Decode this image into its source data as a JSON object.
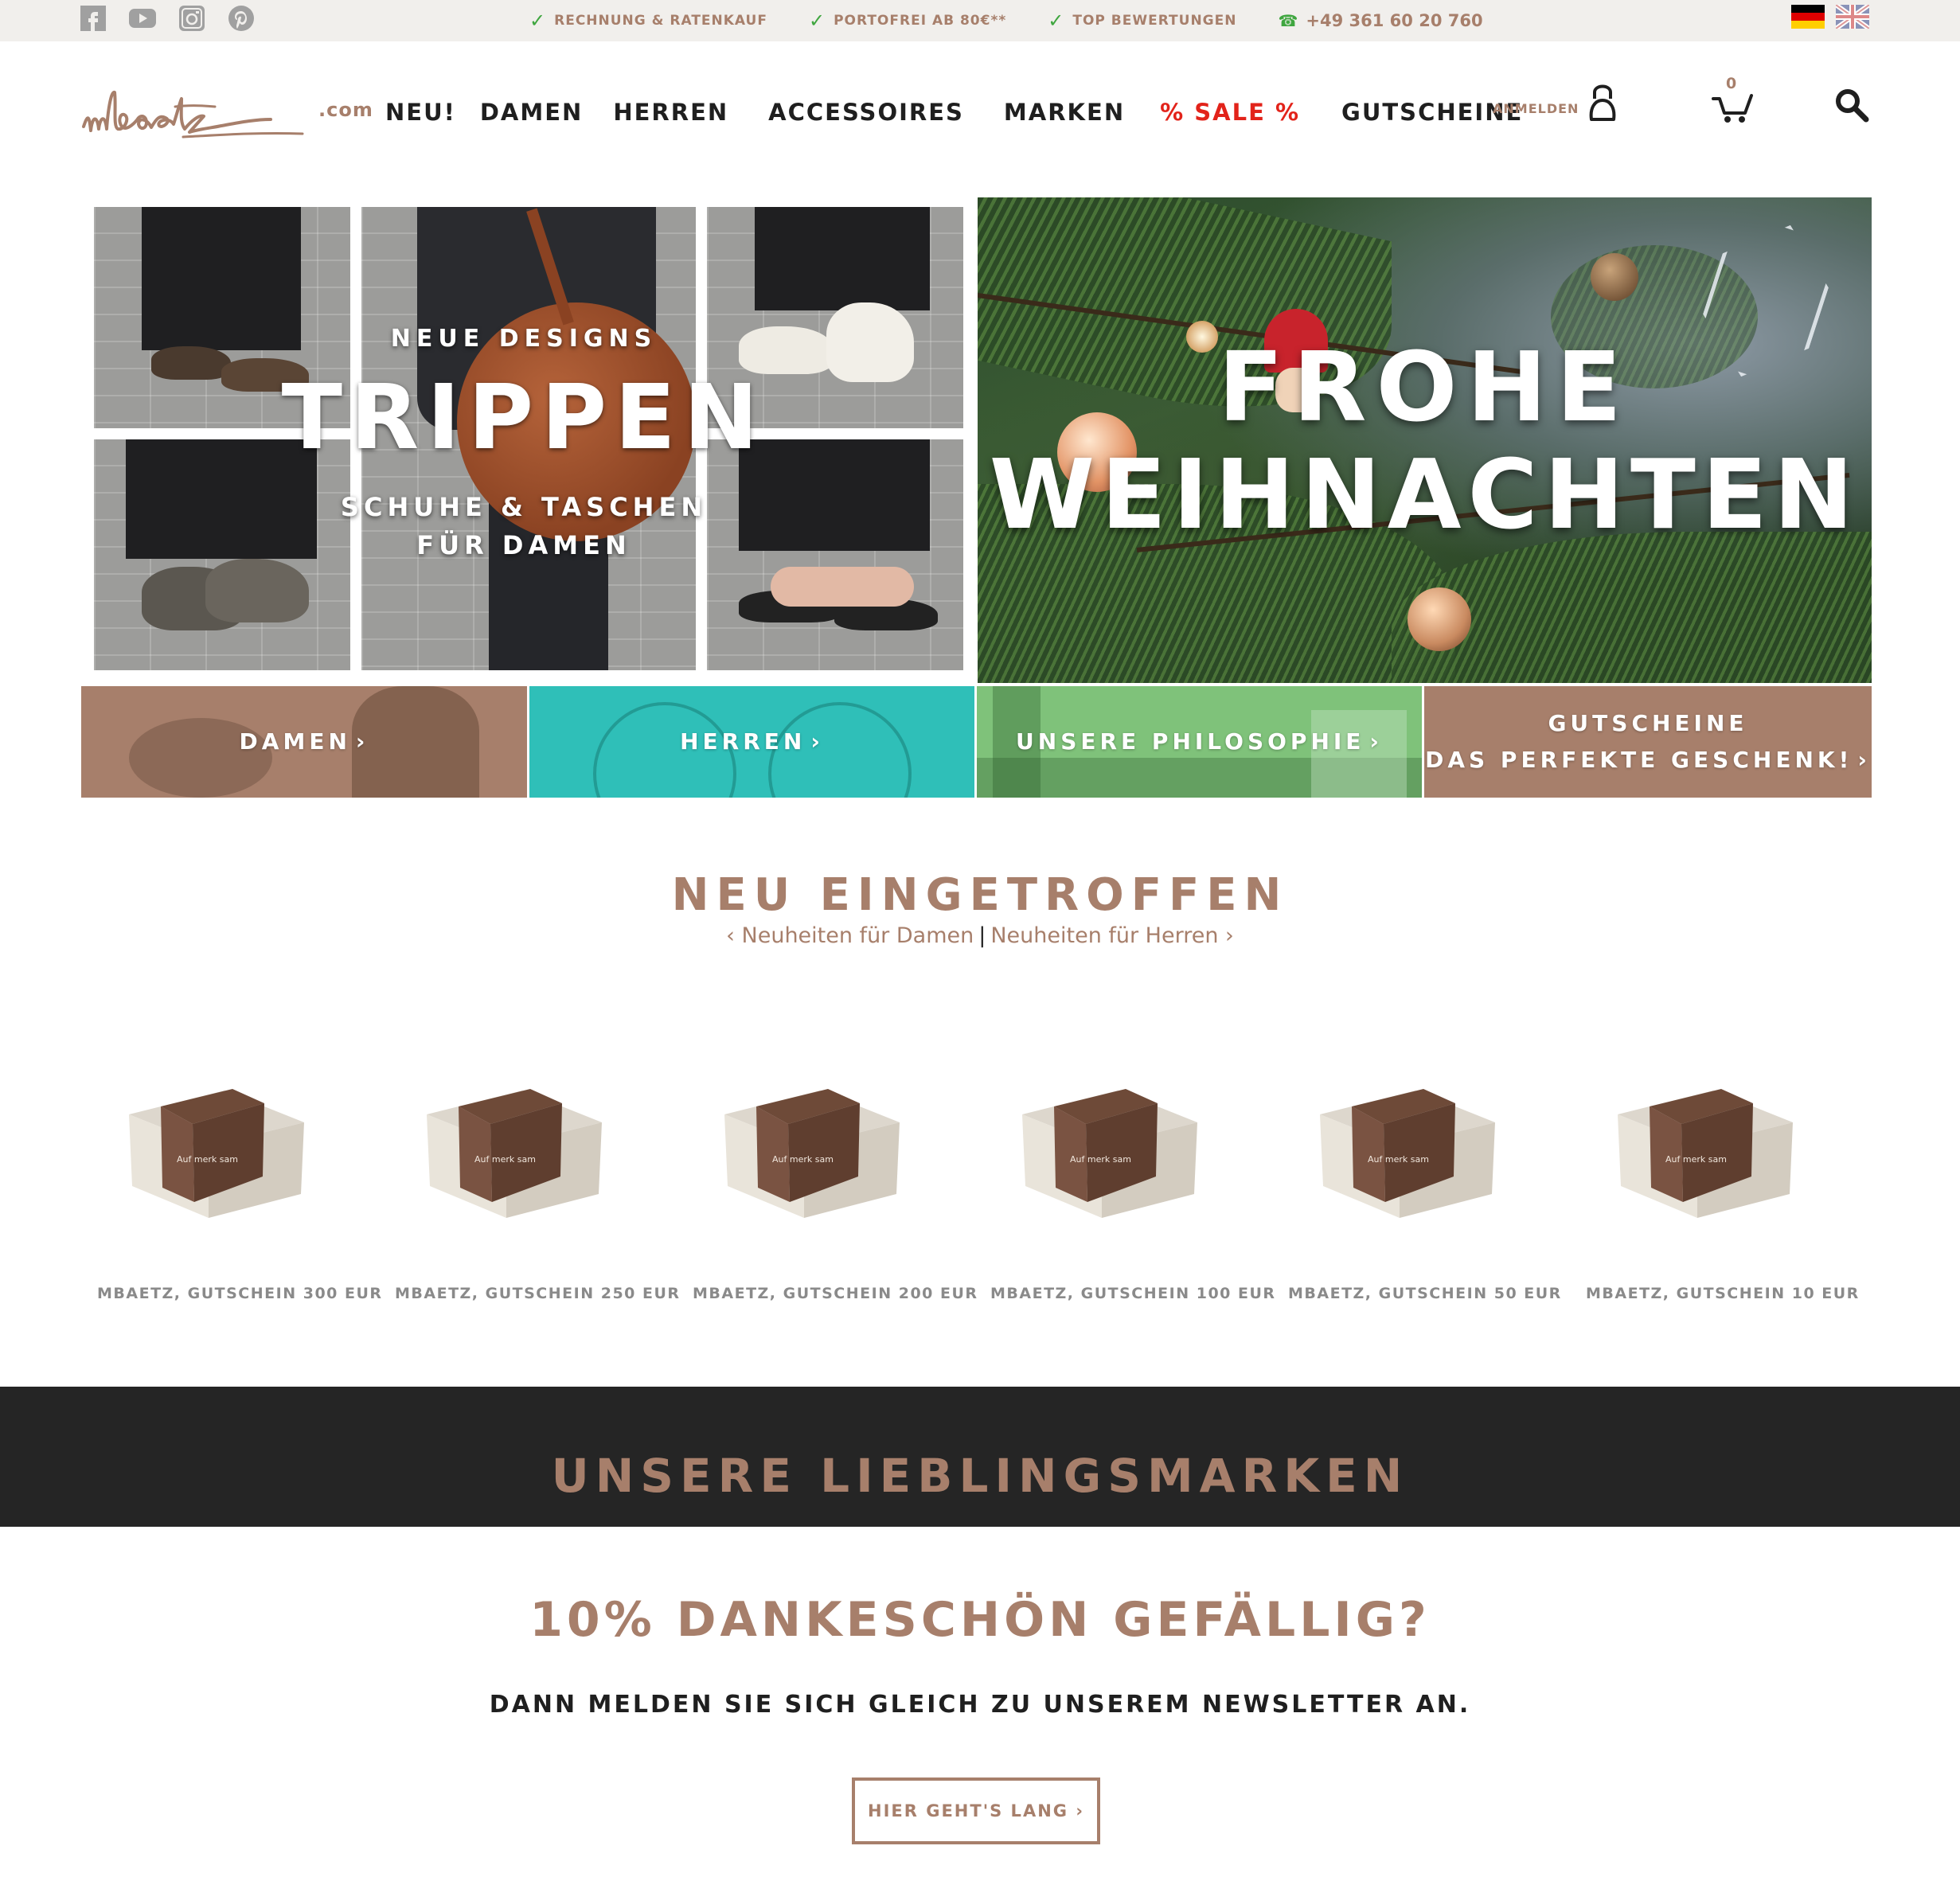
{
  "topbar": {
    "social": [
      {
        "name": "facebook-icon"
      },
      {
        "name": "youtube-icon"
      },
      {
        "name": "instagram-icon"
      },
      {
        "name": "pinterest-icon"
      }
    ],
    "usps": [
      {
        "label": "RECHNUNG & RATENKAUF"
      },
      {
        "label": "PORTOFREI AB 80€**"
      },
      {
        "label": "TOP BEWERTUNGEN"
      }
    ],
    "phone": "+49 361 60 20 760",
    "languages": [
      "de-flag-icon",
      "uk-flag-icon"
    ]
  },
  "header": {
    "logo_text": "mbaetz",
    "logo_suffix": ".com",
    "nav": [
      {
        "label": "NEU!"
      },
      {
        "label": "DAMEN"
      },
      {
        "label": "HERREN"
      },
      {
        "label": "ACCESSOIRES"
      },
      {
        "label": "MARKEN"
      },
      {
        "label": "% SALE %"
      },
      {
        "label": "GUTSCHEINE"
      }
    ],
    "login_label": "ANMELDEN",
    "cart_count": "0"
  },
  "hero": {
    "left": {
      "kicker": "NEUE DESIGNS",
      "title": "TRIPPEN",
      "line1": "SCHUHE & TASCHEN",
      "line2": "FÜR DAMEN"
    },
    "right": {
      "line1": "FROHE",
      "line2": "WEIHNACHTEN"
    }
  },
  "categories": [
    {
      "label": "DAMEN",
      "color": "#a77f6b"
    },
    {
      "label": "HERREN",
      "color": "#2fbfb8"
    },
    {
      "label": "UNSERE PHILOSOPHIE",
      "color": "#7fc27a"
    },
    {
      "label_line1": "GUTSCHEINE",
      "label_line2": "DAS PERFEKTE GESCHENK!",
      "color": "#a77f6b"
    }
  ],
  "new_arrivals": {
    "title": "NEU EINGETROFFEN",
    "link_women": "‹ Neuheiten für Damen",
    "separator": "|",
    "link_men": "Neuheiten für Herren ›",
    "products": [
      {
        "name": "MBAETZ, GUTSCHEIN 300 EUR"
      },
      {
        "name": "MBAETZ, GUTSCHEIN 250 EUR"
      },
      {
        "name": "MBAETZ, GUTSCHEIN 200 EUR"
      },
      {
        "name": "MBAETZ, GUTSCHEIN 100 EUR"
      },
      {
        "name": "MBAETZ, GUTSCHEIN 50 EUR"
      },
      {
        "name": "MBAETZ, GUTSCHEIN 10 EUR"
      }
    ],
    "box_label": "Auf merk sam"
  },
  "brands": {
    "title": "UNSERE LIEBLINGSMARKEN"
  },
  "newsletter": {
    "title": "10% DANKESCHÖN GEFÄLLIG?",
    "subtitle": "DANN MELDEN SIE SICH GLEICH ZU UNSEREM NEWSLETTER AN.",
    "button_label": "HIER GEHT'S LANG ›"
  },
  "colors": {
    "accent": "#a77f6b",
    "sale": "#e2231a",
    "check": "#3fa63f",
    "dark": "#252525"
  }
}
